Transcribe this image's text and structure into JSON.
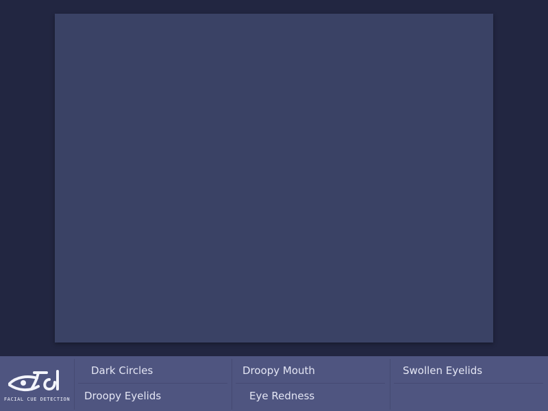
{
  "logo": {
    "caption": "FACIAL CUE DETECTION",
    "text": "FCD"
  },
  "cues": [
    {
      "label": "Dark Circles"
    },
    {
      "label": "Droopy Mouth"
    },
    {
      "label": "Swollen Eyelids"
    },
    {
      "label": "Droopy Eyelids"
    },
    {
      "label": "Eye Redness"
    }
  ],
  "colors": {
    "background": "#222641",
    "viewport": "#3a4265",
    "bottom_bar": "#4f5580",
    "text": "#e4e6f4"
  }
}
